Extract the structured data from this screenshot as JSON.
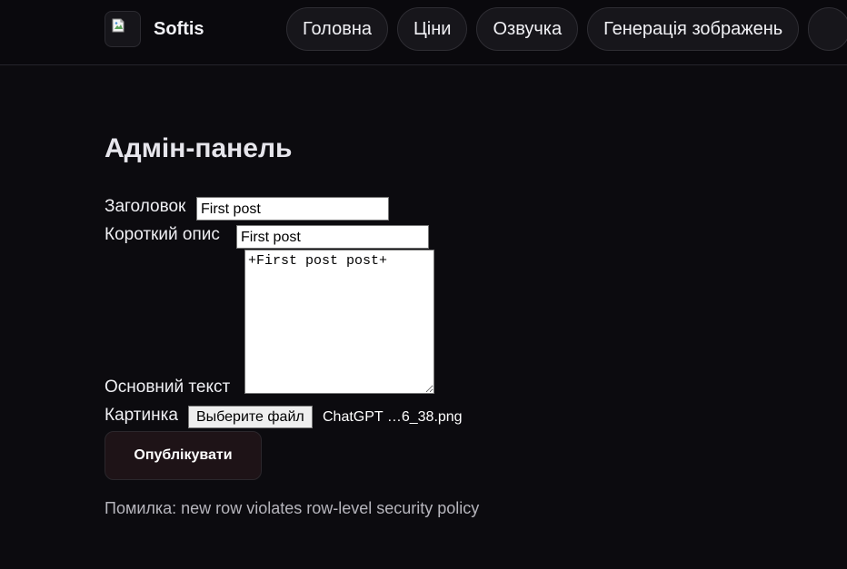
{
  "header": {
    "brand": "Softis",
    "nav": [
      "Головна",
      "Ціни",
      "Озвучка",
      "Генерація зображень"
    ]
  },
  "page": {
    "title": "Адмін-панель"
  },
  "form": {
    "title_label": "Заголовок",
    "title_value": "First post",
    "short_label": "Короткий опис",
    "short_value": "First post",
    "body_label": "Основний текст",
    "body_value": "+First post post+",
    "image_label": "Картинка",
    "file_button": "Выберите файл",
    "file_name": "ChatGPT …6_38.png",
    "submit_label": "Опублікувати"
  },
  "status": {
    "error": "Помилка: new row violates row-level security policy"
  },
  "icons": {
    "logo": "broken-image-icon"
  }
}
